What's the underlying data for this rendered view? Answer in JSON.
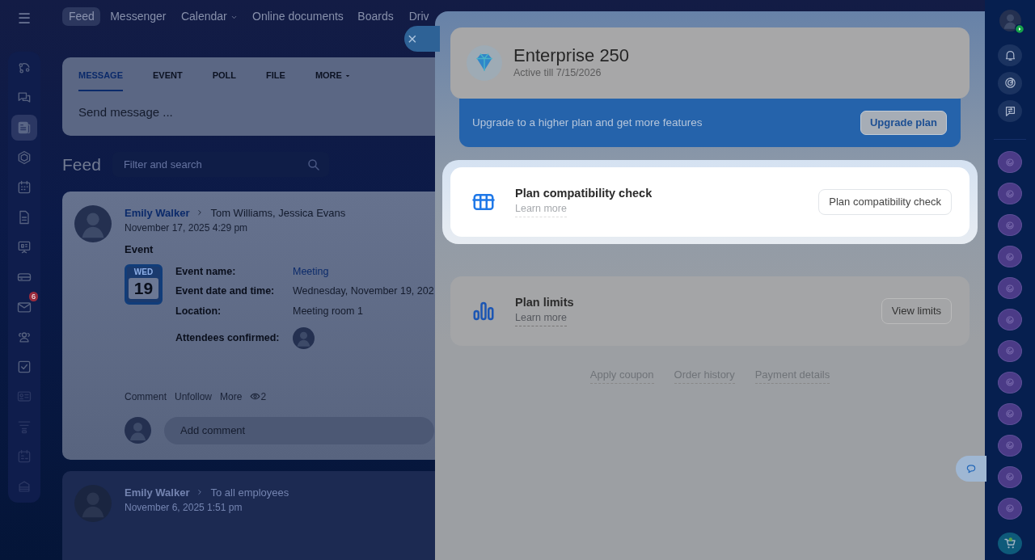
{
  "left_rail": {
    "menu_button": "☰",
    "items": [
      {
        "selected": false
      },
      {
        "selected": false
      },
      {
        "selected": true
      },
      {
        "selected": false
      },
      {
        "selected": false
      },
      {
        "selected": false
      },
      {
        "selected": false
      },
      {
        "selected": false
      },
      {
        "selected": false,
        "badge": "6"
      },
      {
        "selected": false
      },
      {
        "selected": false
      },
      {
        "selected": false
      },
      {
        "selected": false
      },
      {
        "selected": false
      },
      {
        "selected": false
      }
    ]
  },
  "top_nav": [
    {
      "label": "Feed",
      "selected": true,
      "has_menu": false
    },
    {
      "label": "Messenger",
      "selected": false,
      "has_menu": false
    },
    {
      "label": "Calendar",
      "selected": false,
      "has_menu": true
    },
    {
      "label": "Online documents",
      "selected": false,
      "has_menu": false
    },
    {
      "label": "Boards",
      "selected": false,
      "has_menu": false
    },
    {
      "label": "Driv",
      "selected": false,
      "has_menu": false
    }
  ],
  "composer": {
    "tabs": [
      {
        "label": "MESSAGE",
        "selected": true,
        "has_menu": false
      },
      {
        "label": "EVENT",
        "selected": false,
        "has_menu": false
      },
      {
        "label": "POLL",
        "selected": false,
        "has_menu": false
      },
      {
        "label": "FILE",
        "selected": false,
        "has_menu": false
      },
      {
        "label": "MORE",
        "selected": false,
        "has_menu": true
      }
    ],
    "placeholder": "Send message ..."
  },
  "feed": {
    "title": "Feed",
    "search_placeholder": "Filter and search"
  },
  "posts": [
    {
      "author": "Emily Walker",
      "recipients": "Tom Williams, Jessica Evans",
      "time": "November 17, 2025 4:29 pm",
      "type_label": "Event",
      "calendar": {
        "weekday": "WED",
        "day": "19"
      },
      "fields": [
        {
          "label": "Event name:",
          "kind": "link",
          "value": "Meeting"
        },
        {
          "label": "Event date and time:",
          "kind": "text",
          "value": "Wednesday, November 19, 202"
        },
        {
          "label": "Location:",
          "kind": "text",
          "value": "Meeting room 1"
        },
        {
          "label": "Attendees confirmed:",
          "kind": "avatars"
        }
      ],
      "actions": [
        "Comment",
        "Unfollow",
        "More"
      ],
      "views": "2",
      "comment_placeholder": "Add comment"
    },
    {
      "author": "Emily Walker",
      "recipients": "To all employees",
      "time": "November 6, 2025 1:51 pm"
    }
  ],
  "close_button": "×",
  "panel": {
    "plan": {
      "name": "Enterprise 250",
      "active_till": "Active till 7/15/2026"
    },
    "upgrade": {
      "text": "Upgrade to a higher plan and get more features",
      "button": "Upgrade plan"
    },
    "features": [
      {
        "kind": "compatibility",
        "title": "Plan compatibility check",
        "link": "Learn more",
        "button": "Plan compatibility check",
        "highlighted": true
      },
      {
        "kind": "limits",
        "title": "Plan limits",
        "link": "Learn more",
        "button": "View limits",
        "highlighted": false
      }
    ],
    "footer_links": [
      "Apply coupon",
      "Order history",
      "Payment details"
    ]
  },
  "right_rail": {
    "status_online": true
  }
}
